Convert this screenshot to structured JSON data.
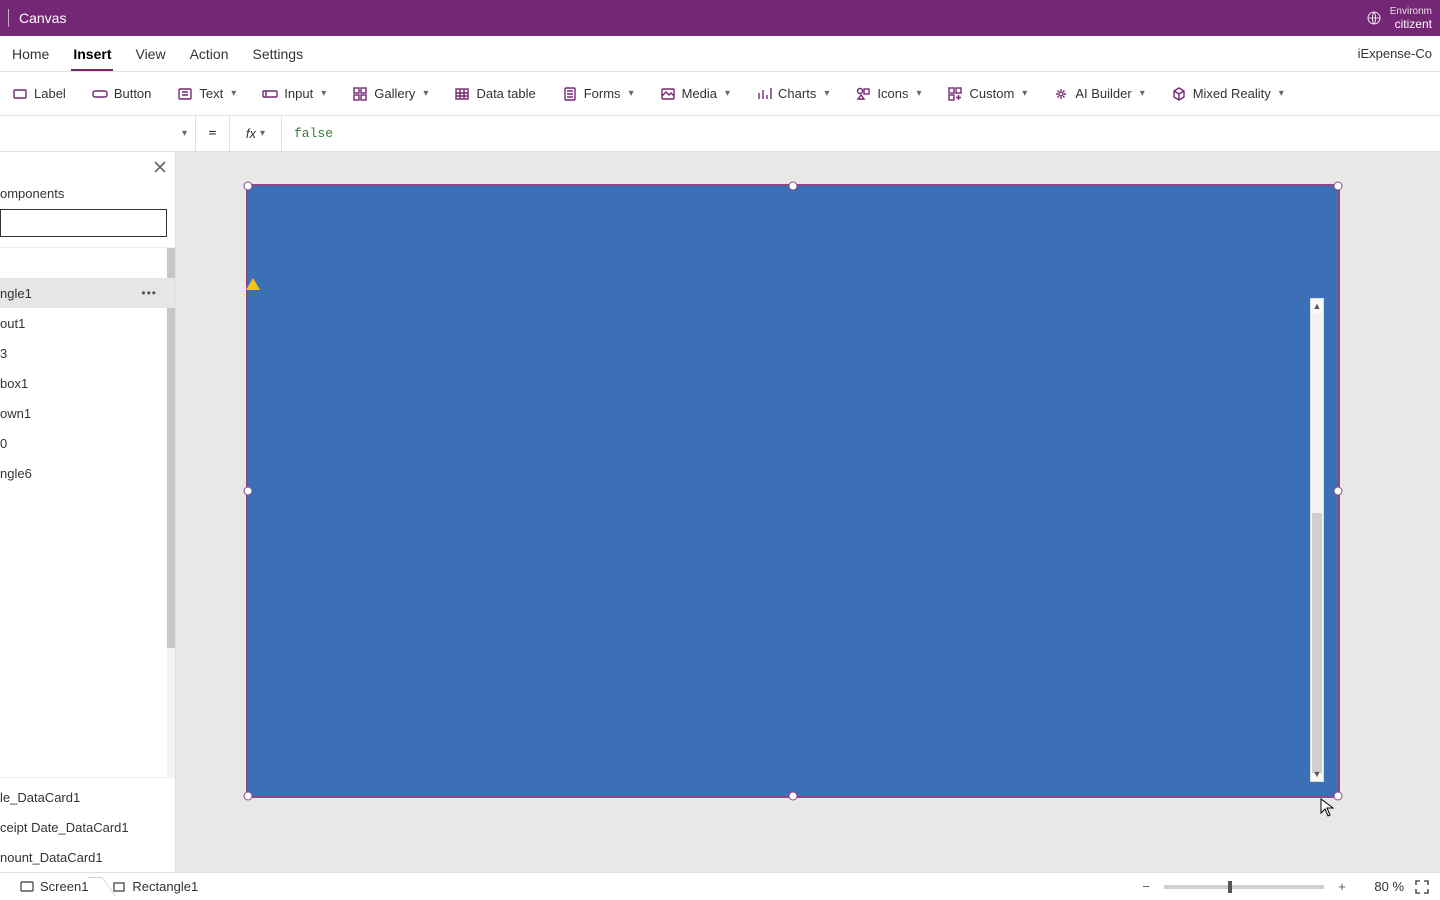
{
  "titlebar": {
    "app_title": "Canvas",
    "env_label": "Environm",
    "env_name": "citizent"
  },
  "menubar": {
    "tabs": [
      "Home",
      "Insert",
      "View",
      "Action",
      "Settings"
    ],
    "active_index": 1,
    "right_text": "iExpense-Co"
  },
  "ribbon": {
    "items": [
      {
        "label": "Label",
        "icon": "label-icon",
        "has_chevron": false
      },
      {
        "label": "Button",
        "icon": "button-icon",
        "has_chevron": false
      },
      {
        "label": "Text",
        "icon": "text-icon",
        "has_chevron": true
      },
      {
        "label": "Input",
        "icon": "input-icon",
        "has_chevron": true
      },
      {
        "label": "Gallery",
        "icon": "gallery-icon",
        "has_chevron": true
      },
      {
        "label": "Data table",
        "icon": "datatable-icon",
        "has_chevron": false
      },
      {
        "label": "Forms",
        "icon": "forms-icon",
        "has_chevron": true
      },
      {
        "label": "Media",
        "icon": "media-icon",
        "has_chevron": true
      },
      {
        "label": "Charts",
        "icon": "charts-icon",
        "has_chevron": true
      },
      {
        "label": "Icons",
        "icon": "icons-icon",
        "has_chevron": true
      },
      {
        "label": "Custom",
        "icon": "custom-icon",
        "has_chevron": true
      },
      {
        "label": "AI Builder",
        "icon": "aibuilder-icon",
        "has_chevron": true
      },
      {
        "label": "Mixed Reality",
        "icon": "mr-icon",
        "has_chevron": true
      }
    ]
  },
  "formula": {
    "property": "",
    "equals": "=",
    "fx": "fx",
    "value": "false"
  },
  "sidebar": {
    "tab_label": "omponents",
    "search_value": "",
    "tree": [
      {
        "label": "ngle1",
        "selected": true,
        "has_more": true
      },
      {
        "label": "out1",
        "selected": false,
        "has_more": false
      },
      {
        "label": "3",
        "selected": false,
        "has_more": false
      },
      {
        "label": "box1",
        "selected": false,
        "has_more": false
      },
      {
        "label": "own1",
        "selected": false,
        "has_more": false
      },
      {
        "label": "0",
        "selected": false,
        "has_more": false
      },
      {
        "label": "ngle6",
        "selected": false,
        "has_more": false
      }
    ],
    "tree_bottom": [
      {
        "label": "le_DataCard1"
      },
      {
        "label": "ceipt Date_DataCard1"
      },
      {
        "label": "nount_DataCard1"
      }
    ]
  },
  "statusbar": {
    "crumbs": [
      {
        "label": "Screen1",
        "icon": "screen-icon"
      },
      {
        "label": "Rectangle1",
        "icon": "rectangle-icon"
      }
    ],
    "zoom_percent": "80",
    "zoom_unit": "%"
  }
}
